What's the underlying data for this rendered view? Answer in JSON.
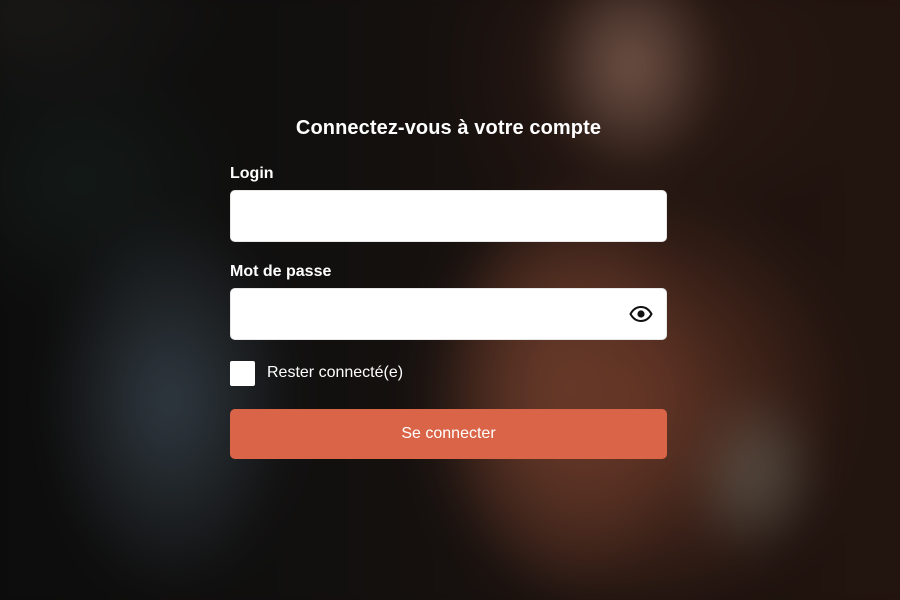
{
  "form": {
    "title": "Connectez-vous à votre compte",
    "login_label": "Login",
    "login_value": "",
    "password_label": "Mot de passe",
    "password_value": "",
    "password_toggle_icon": "eye-icon",
    "remember_label": "Rester connecté(e)",
    "remember_checked": false,
    "submit_label": "Se connecter"
  },
  "colors": {
    "accent": "#da6448",
    "input_background": "#ffffff",
    "text": "#ffffff"
  }
}
